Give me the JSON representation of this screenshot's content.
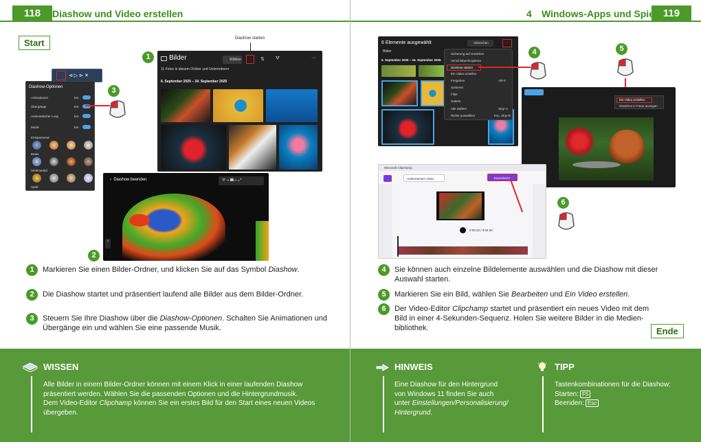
{
  "left": {
    "page_number": "118",
    "title": "Diashow und Video erstellen",
    "start_label": "Start",
    "callout_label": "Diashow starten",
    "bilder_app": {
      "title": "Bilder",
      "subtitle": "11 Fotos in diesem Ordner und Unterordnern",
      "date_range": "6. September 2025 – 24. September 2025",
      "select_button": "Wählen"
    },
    "options_panel": {
      "title": "Diashow-Optionen",
      "rows": [
        {
          "label": "Animationen",
          "state": "Ein"
        },
        {
          "label": "Übergänge",
          "state": "Ein"
        },
        {
          "label": "Automatischer Loop",
          "state": "Ein"
        },
        {
          "label": "Musik",
          "state": "Ein"
        }
      ],
      "sections": [
        "Entspannend",
        "Beats",
        "Sentimental",
        "Spaß"
      ]
    },
    "slideshow": {
      "end_label": "Diashow beenden"
    },
    "steps": [
      {
        "num": "1",
        "pre": "Markieren Sie einen Bilder-Ordner, und klicken Sie auf das Symbol ",
        "em": "Diashow",
        "post": ".",
        "l2pre": "",
        "l2em": "",
        "l2post": ""
      },
      {
        "num": "2",
        "pre": "Die Diashow startet und präsentiert laufend alle Bilder aus dem Bilder-Ordner.",
        "em": "",
        "post": "",
        "l2pre": "",
        "l2em": "",
        "l2post": ""
      },
      {
        "num": "3",
        "pre": "Steuern Sie Ihre Diashow über die ",
        "em": "Diashow-Optionen",
        "post": ". Schalten Sie Animationen und",
        "l2pre": "Übergänge ein und wählen Sie eine passende Musik.",
        "l2em": "",
        "l2post": ""
      }
    ],
    "wissen": {
      "title": "WISSEN",
      "lines": [
        "Alle Bilder in einem Bilder-Ordner können mit einem Klick in einer laufenden Diashow",
        "präsentiert werden. Wählen Sie die passenden Optionen und die Hintergrundmusik."
      ],
      "line3_pre": "Dem Video-Editor ",
      "line3_em": "Clipchamp",
      "line3_post": " können Sie ein erstes Bild für den Start eines neuen Videos",
      "line4": "übergeben."
    }
  },
  "right": {
    "chapter_number": "4",
    "title": "Windows-Apps und Spiele",
    "page_number": "119",
    "end_label": "Ende",
    "selection_app": {
      "title": "6 Elemente ausgewählt",
      "folder": "Bilder",
      "date": "6. September 2025 – 24. September 2025",
      "cancel": "Abbrechen",
      "menu": [
        "Sicherung auf OneDrive",
        "Verschieben/Kopieren",
        "Diashow starten",
        "Ein Video erstellen",
        "Freigeben",
        "Sortieren",
        "Filter",
        "Galerie",
        "Alle wählen",
        "Nichts auswählen"
      ],
      "shortcuts": [
        "",
        "",
        "",
        "",
        "Alt+S",
        "",
        "",
        "",
        "Strg+A",
        "Esc, Strg+D"
      ]
    },
    "edit_app": {
      "menu": [
        "Ein Video erstellen",
        "OneDrive in Fotos anzeigen"
      ]
    },
    "clipchamp": {
      "title": "Microsoft Clipchamp",
      "project": "Unbenanntes Video",
      "export": "Exportieren",
      "time": "0:00.00 / 0:04.00"
    },
    "steps": [
      {
        "num": "4",
        "l1": "Sie können auch einzelne Bildelemente auswählen und die Diashow mit dieser",
        "l2": "Auswahl starten."
      },
      {
        "num": "5",
        "pre": "Markieren Sie ein Bild, wählen Sie ",
        "em1": "Bearbeiten",
        "mid": " und ",
        "em2": "Ein Video erstellen",
        "post": "."
      },
      {
        "num": "6",
        "pre": "Der Video-Editor ",
        "em": "Clipchamp",
        "post": " startet und präsentiert ein neues Video mit dem",
        "l2": "Bild in einer 4-Sekunden-Sequenz. Holen Sie weitere Bilder in die Medien-",
        "l3": "bibliothek."
      }
    ],
    "hinweis": {
      "title": "HINWEIS",
      "l1": "Eine Diashow für den Hintergrund",
      "l2": "von Windows 11 finden Sie auch",
      "l3pre": "unter ",
      "l3em": "Einstellungen/Personalisierung/",
      "l4em": "Hintergrund",
      "l4post": "."
    },
    "tipp": {
      "title": "TIPP",
      "l1": "Tastenkombinationen für die Diashow:",
      "start_label": "Starten:",
      "start_key": "F5",
      "end_label": "Beenden:",
      "end_key": "Esc"
    }
  },
  "colors": {
    "accent": "#4c9a2a",
    "box": "#58993a",
    "highlight": "#d0202a"
  }
}
